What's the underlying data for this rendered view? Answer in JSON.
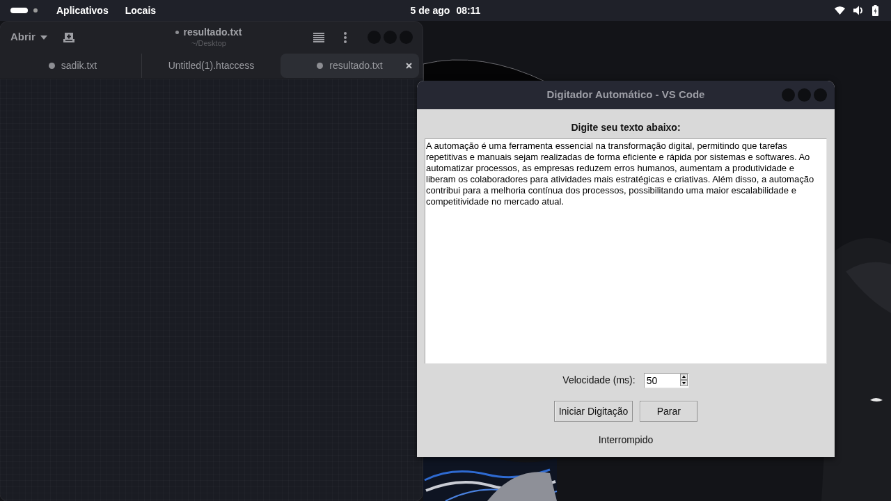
{
  "top_bar": {
    "workspaces": [
      {
        "selected": true
      },
      {
        "selected": false
      }
    ],
    "menus": [
      "Aplicativos",
      "Locais"
    ],
    "clock": {
      "date": "5 de ago",
      "time": "08:11"
    }
  },
  "editor_window": {
    "open_button": "Abrir",
    "title": "resultado.txt",
    "modified": true,
    "subtitle": "~/Desktop",
    "tabs": [
      {
        "label": "sadik.txt",
        "modified": true,
        "selected": false
      },
      {
        "label": "Untitled(1).htaccess",
        "modified": false,
        "selected": false
      },
      {
        "label": "resultado.txt",
        "modified": true,
        "selected": true
      }
    ]
  },
  "typer_window": {
    "title": "Digitador Automático - VS Code",
    "prompt": "Digite seu texto abaixo:",
    "text": "A automação é uma ferramenta essencial na transformação digital, permitindo que tarefas repetitivas e manuais sejam realizadas de forma eficiente e rápida por sistemas e softwares. Ao automatizar processos, as empresas reduzem erros humanos, aumentam a produtividade e liberam os colaboradores para atividades mais estratégicas e criativas. Além disso, a automação contribui para a melhoria contínua dos processos, possibilitando uma maior escalabilidade e competitividade no mercado atual.",
    "speed": {
      "label": "Velocidade (ms):",
      "value": "50"
    },
    "buttons": [
      "Iniciar Digitação",
      "Parar"
    ],
    "status": "Interrompido"
  }
}
